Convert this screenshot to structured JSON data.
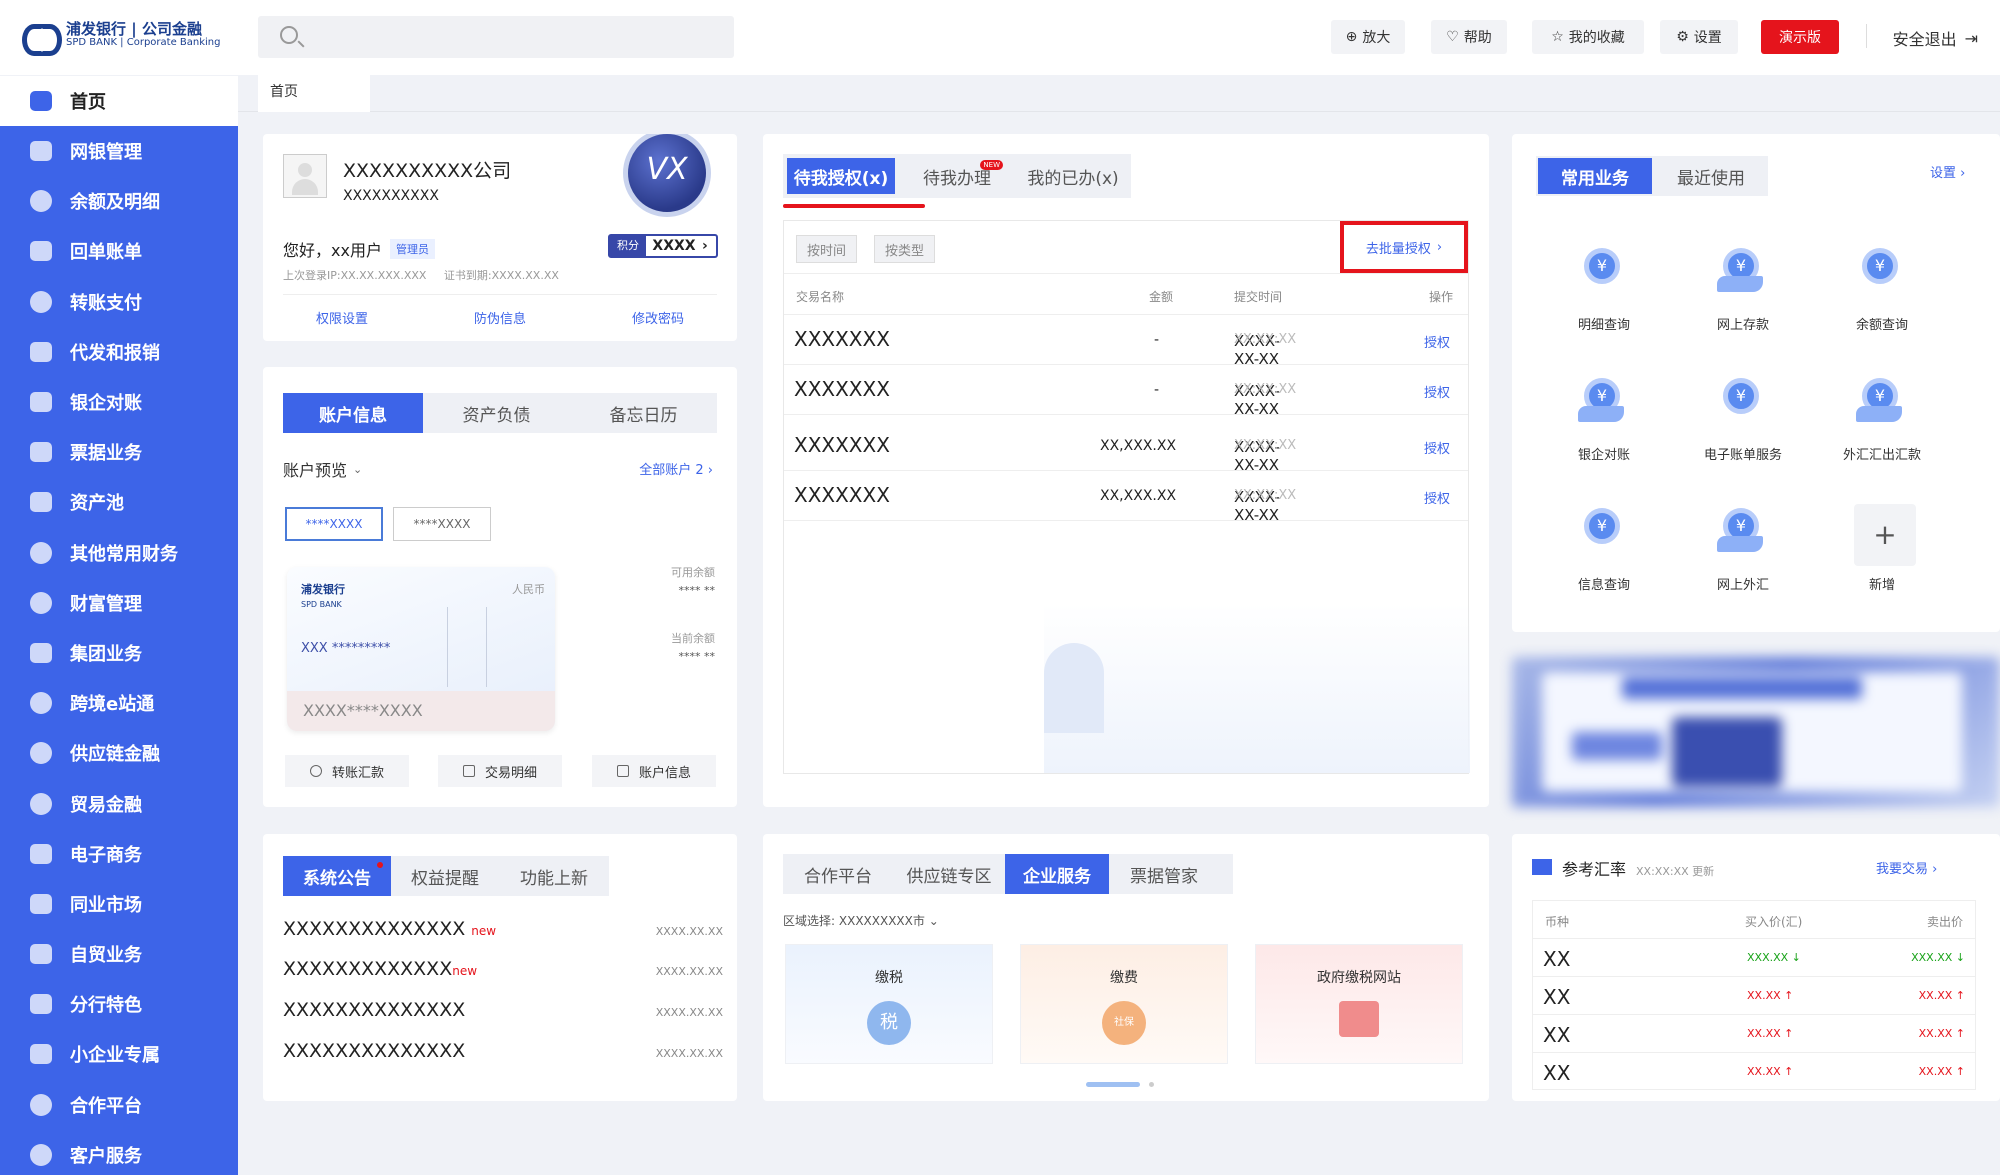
{
  "brand": {
    "name_cn": "浦发银行",
    "name_en": "SPD BANK",
    "division_cn": "公司金融",
    "division_en": "Corporate Banking",
    "primary_color": "#3d64e8",
    "accent_red": "#e5141c"
  },
  "topbar": {
    "zoom": "放大",
    "help": "帮助",
    "favorites": "我的收藏",
    "settings": "设置",
    "demo": "演示版",
    "logout": "安全退出"
  },
  "sidebar": {
    "home": "首页",
    "items": [
      "网银管理",
      "余额及明细",
      "回单账单",
      "转账支付",
      "代发和报销",
      "银企对账",
      "票据业务",
      "资产池",
      "其他常用财务",
      "财富管理",
      "集团业务",
      "跨境e站通",
      "供应链金融",
      "贸易金融",
      "电子商务",
      "同业市场",
      "自贸业务",
      "分行特色",
      "小企业专属",
      "合作平台",
      "客户服务"
    ]
  },
  "breadcrumb": {
    "current": "首页"
  },
  "company": {
    "name": "XXXXXXXXXX公司",
    "id": "XXXXXXXXXX",
    "greeting": "您好，xx用户",
    "role": "管理员",
    "last_login": "上次登录IP:XX.XX.XXX.XXX",
    "cert_expiry": "证书到期:XXXX.XX.XX",
    "medal_text": "VX",
    "points_label": "积分",
    "points_value": "XXXX",
    "links": [
      "权限设置",
      "防伪信息",
      "修改密码"
    ]
  },
  "account": {
    "tabs": [
      "账户信息",
      "资产负债",
      "备忘日历"
    ],
    "preview_label": "账户预览",
    "all_accounts": "全部账户 2",
    "chips": [
      "****XXXX",
      "****XXXX"
    ],
    "card_bank": "浦发银行",
    "card_bank_en": "SPD BANK",
    "card_currency": "人民币",
    "card_number": "XXX *********",
    "card_bottom": "XXXX****XXXX",
    "available_label": "可用余额",
    "available_value": "**** **",
    "current_label": "当前余额",
    "current_value": "**** **",
    "actions": [
      "转账汇款",
      "交易明细",
      "账户信息"
    ]
  },
  "pending": {
    "tabs": [
      "待我授权(x)",
      "待我办理",
      "我的已办(x)"
    ],
    "new_badge": "NEW",
    "filters": [
      "按时间",
      "按类型"
    ],
    "batch": "去批量授权",
    "headers": [
      "交易名称",
      "金额",
      "提交时间",
      "操作"
    ],
    "rows": [
      {
        "name": "XXXXXXX",
        "amount": "-",
        "date": "XXXX-XX-XX",
        "time": "XX:XX:XX",
        "op": "授权"
      },
      {
        "name": "XXXXXXX",
        "amount": "-",
        "date": "XXXX-XX-XX",
        "time": "XX:XX:XX",
        "op": "授权"
      },
      {
        "name": "XXXXXXX",
        "amount": "XX,XXX.XX",
        "date": "XXXX-XX-XX",
        "time": "XX:XX:XX",
        "op": "授权"
      },
      {
        "name": "XXXXXXX",
        "amount": "XX,XXX.XX",
        "date": "XXXX-XX-XX",
        "time": "XX:XX:XX",
        "op": "授权"
      }
    ]
  },
  "business": {
    "tabs": [
      "常用业务",
      "最近使用"
    ],
    "settings": "设置",
    "items": [
      "明细查询",
      "网上存款",
      "余额查询",
      "银企对账",
      "电子账单服务",
      "外汇汇出汇款",
      "信息查询",
      "网上外汇",
      "新增"
    ]
  },
  "notices": {
    "tabs": [
      "系统公告",
      "权益提醒",
      "功能上新"
    ],
    "rows": [
      {
        "title": "XXXXXXXXXXXXXX",
        "tag": "new",
        "date": "XXXX.XX.XX"
      },
      {
        "title": "XXXXXXXXXXXXX",
        "tag": "new",
        "date": "XXXX.XX.XX"
      },
      {
        "title": "XXXXXXXXXXXXXX",
        "tag": "",
        "date": "XXXX.XX.XX"
      },
      {
        "title": "XXXXXXXXXXXXXX",
        "tag": "",
        "date": "XXXX.XX.XX"
      }
    ]
  },
  "coop": {
    "tabs": [
      "合作平台",
      "供应链专区",
      "企业服务",
      "票据管家"
    ],
    "region_label": "区域选择:",
    "region_value": "XXXXXXXXX市",
    "services": [
      "缴税",
      "缴费",
      "政府缴税网站"
    ],
    "icon_glyphs": [
      "税",
      "社保",
      ""
    ]
  },
  "fx": {
    "title": "参考汇率",
    "updated": "XX:XX:XX 更新",
    "trade": "我要交易",
    "headers": [
      "币种",
      "买入价(汇)",
      "卖出价"
    ],
    "rows": [
      {
        "cur": "XX",
        "buy": "XXX.XX ↓",
        "sell": "XXX.XX ↓",
        "color": "green"
      },
      {
        "cur": "XX",
        "buy": "XX.XX ↑",
        "sell": "XX.XX ↑",
        "color": "red"
      },
      {
        "cur": "XX",
        "buy": "XX.XX ↑",
        "sell": "XX.XX ↑",
        "color": "red"
      },
      {
        "cur": "XX",
        "buy": "XX.XX ↑",
        "sell": "XX.XX ↑",
        "color": "red"
      }
    ]
  }
}
